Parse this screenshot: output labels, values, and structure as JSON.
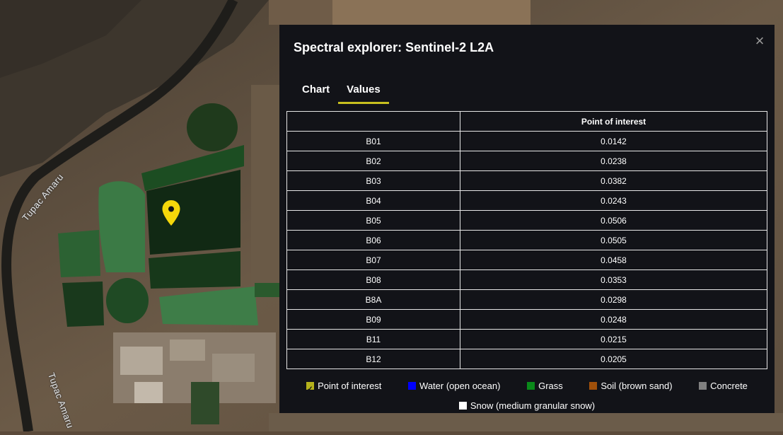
{
  "map": {
    "road_labels": [
      "Tupac Amaru",
      "Tupac Amaru"
    ],
    "marker_icon": "map-pin-icon",
    "marker_color": "#f5d70a"
  },
  "dialog": {
    "title": "Spectral explorer: Sentinel-2 L2A",
    "close_icon": "close-icon",
    "tabs": [
      {
        "label": "Chart",
        "active": false
      },
      {
        "label": "Values",
        "active": true
      }
    ],
    "accent_color": "#c8c01f",
    "table": {
      "headers": [
        "",
        "Point of interest"
      ],
      "rows": [
        [
          "B01",
          "0.0142"
        ],
        [
          "B02",
          "0.0238"
        ],
        [
          "B03",
          "0.0382"
        ],
        [
          "B04",
          "0.0243"
        ],
        [
          "B05",
          "0.0506"
        ],
        [
          "B06",
          "0.0505"
        ],
        [
          "B07",
          "0.0458"
        ],
        [
          "B08",
          "0.0353"
        ],
        [
          "B8A",
          "0.0298"
        ],
        [
          "B09",
          "0.0248"
        ],
        [
          "B11",
          "0.0215"
        ],
        [
          "B12",
          "0.0205"
        ]
      ]
    },
    "legend": [
      {
        "label": "Point of interest",
        "color": "#b5b21c",
        "checked": true
      },
      {
        "label": "Water (open ocean)",
        "color": "#0000ff",
        "checked": false
      },
      {
        "label": "Grass",
        "color": "#0a8a1a",
        "checked": false
      },
      {
        "label": "Soil (brown sand)",
        "color": "#a0500a",
        "checked": false
      },
      {
        "label": "Concrete",
        "color": "#808080",
        "checked": false
      },
      {
        "label": "Snow (medium granular snow)",
        "color": "#ffffff",
        "checked": false
      }
    ]
  }
}
